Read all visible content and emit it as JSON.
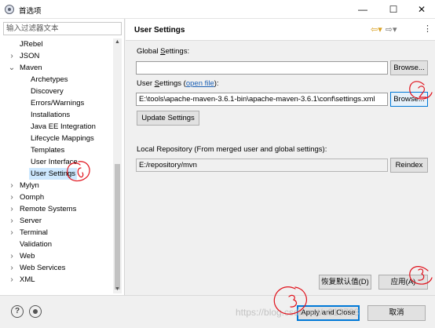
{
  "window": {
    "title": "首选项",
    "minimize_label": "—",
    "maximize_label": "☐",
    "close_label": "✕"
  },
  "sidebar": {
    "filter_placeholder": "输入过滤器文本",
    "items": [
      {
        "label": "JRebel",
        "level": 0,
        "arrow": ""
      },
      {
        "label": "JSON",
        "level": 0,
        "arrow": "›"
      },
      {
        "label": "Maven",
        "level": 0,
        "arrow": "⌄"
      },
      {
        "label": "Archetypes",
        "level": 1
      },
      {
        "label": "Discovery",
        "level": 1
      },
      {
        "label": "Errors/Warnings",
        "level": 1
      },
      {
        "label": "Installations",
        "level": 1
      },
      {
        "label": "Java EE Integration",
        "level": 1
      },
      {
        "label": "Lifecycle Mappings",
        "level": 1
      },
      {
        "label": "Templates",
        "level": 1
      },
      {
        "label": "User Interface",
        "level": 1
      },
      {
        "label": "User Settings",
        "level": 1,
        "selected": true
      },
      {
        "label": "Mylyn",
        "level": 0,
        "arrow": "›"
      },
      {
        "label": "Oomph",
        "level": 0,
        "arrow": "›"
      },
      {
        "label": "Remote Systems",
        "level": 0,
        "arrow": "›"
      },
      {
        "label": "Server",
        "level": 0,
        "arrow": "›"
      },
      {
        "label": "Terminal",
        "level": 0,
        "arrow": "›"
      },
      {
        "label": "Validation",
        "level": 0,
        "arrow": ""
      },
      {
        "label": "Web",
        "level": 0,
        "arrow": "›"
      },
      {
        "label": "Web Services",
        "level": 0,
        "arrow": "›"
      },
      {
        "label": "XML",
        "level": 0,
        "arrow": "›"
      }
    ]
  },
  "page": {
    "title": "User Settings",
    "global_label_pre": "Global ",
    "global_label_accel": "S",
    "global_label_post": "ettings:",
    "global_value": "",
    "browse_label": "Browse...",
    "user_label_pre": "User ",
    "user_label_accel": "S",
    "user_label_mid": "ettings (",
    "user_link": "open file",
    "user_label_post": "):",
    "user_value": "E:\\tools\\apache-maven-3.6.1-bin\\apache-maven-3.6.1\\conf\\settings.xml",
    "update_label": "Update Settings",
    "local_repo_label": "Local Repository (From merged user and global settings):",
    "local_repo_value": "E:/repository/mvn",
    "reindex_label": "Reindex",
    "restore_defaults_label": "恢复默认值(D)",
    "apply_label": "应用(A)"
  },
  "footer": {
    "help_icon_glyph": "?",
    "apply_close_label": "Apply and Close",
    "cancel_label": "取消",
    "watermark": "https://blog.csdn.net/u013798"
  },
  "colors": {
    "selection": "#cde8ff",
    "annotation": "#e0101a",
    "link": "#1a5fb4",
    "focus": "#0078d7"
  }
}
